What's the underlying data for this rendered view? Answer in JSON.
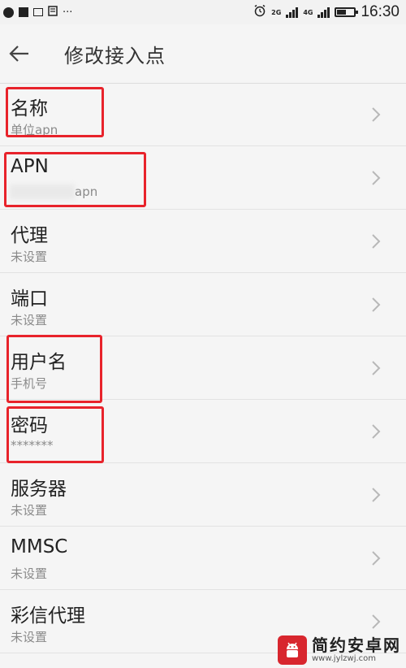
{
  "status_bar": {
    "left_icons": [
      "app-icon",
      "stop-icon",
      "sim-icon",
      "notes-icon",
      "more-icon"
    ],
    "more_glyph": "···",
    "network_a": "2G",
    "network_b": "4G",
    "battery_level": 0.5,
    "time": "16:30"
  },
  "app_bar": {
    "title": "修改接入点"
  },
  "rows": [
    {
      "label": "名称",
      "value": "单位apn"
    },
    {
      "label": "APN",
      "value": "apn"
    },
    {
      "label": "代理",
      "value": "未设置"
    },
    {
      "label": "端口",
      "value": "未设置"
    },
    {
      "label": "用户名",
      "value": "手机号"
    },
    {
      "label": "密码",
      "value": "*******"
    },
    {
      "label": "服务器",
      "value": "未设置"
    },
    {
      "label": "MMSC",
      "value": "未设置"
    },
    {
      "label": "彩信代理",
      "value": "未设置"
    }
  ],
  "watermark": {
    "name": "简约安卓网",
    "url": "www.jylzwj.com"
  },
  "colors": {
    "highlight": "#e8232b",
    "background": "#f5f5f5",
    "watermark": "#d8262e"
  }
}
